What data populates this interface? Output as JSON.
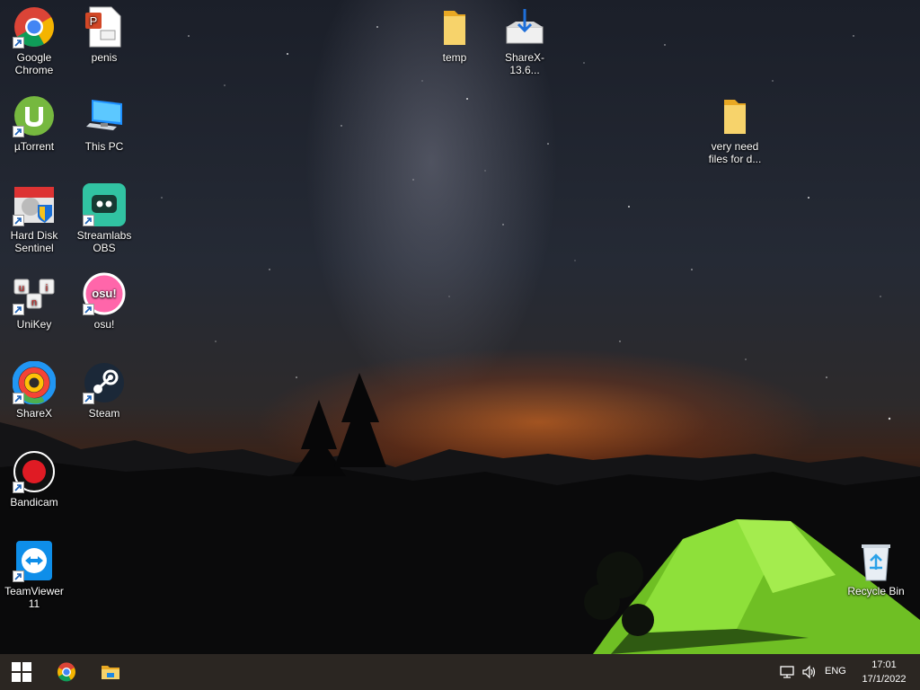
{
  "desktop_icons": {
    "chrome": "Google Chrome",
    "penis": "penis",
    "temp": "temp",
    "sharex_installer": "ShareX-13.6...",
    "utorrent": "µTorrent",
    "this_pc": "This PC",
    "very_need": "very need files for d...",
    "hdsentinel": "Hard Disk Sentinel",
    "streamlabs": "Streamlabs OBS",
    "unikey": "UniKey",
    "osu": "osu!",
    "sharex": "ShareX",
    "steam": "Steam",
    "bandicam": "Bandicam",
    "teamviewer": "TeamViewer 11",
    "recycle_bin": "Recycle Bin"
  },
  "taskbar": {
    "language": "ENG",
    "time": "17:01",
    "date": "17/1/2022"
  },
  "icons_meta": {
    "start": "windows-logo-icon",
    "pinned": [
      "chrome-icon",
      "file-explorer-icon"
    ],
    "tray": [
      "network-icon",
      "volume-icon"
    ]
  },
  "colors": {
    "taskbar": "#2b2622",
    "folder": "#f2c14e",
    "tent": "#8ee03a"
  }
}
